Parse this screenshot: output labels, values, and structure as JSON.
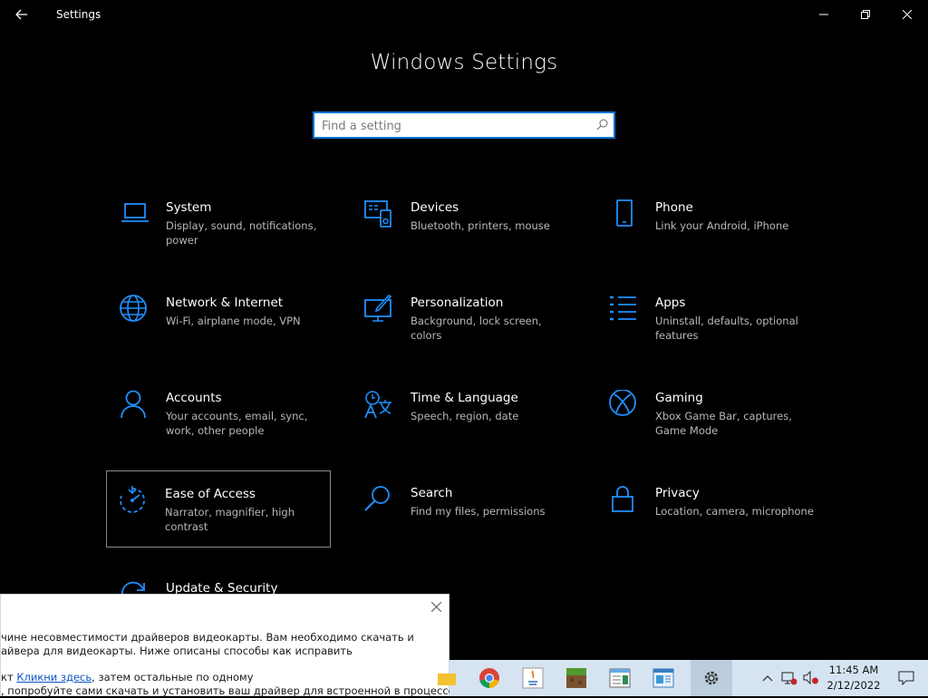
{
  "window": {
    "title": "Settings"
  },
  "heading": "Windows Settings",
  "search": {
    "placeholder": "Find a setting",
    "value": ""
  },
  "colors": {
    "accent": "#0a74d6",
    "background": "#000000",
    "taskbar": "#d6e4f2"
  },
  "tiles": [
    {
      "name": "System",
      "desc": "Display, sound, notifications, power",
      "icon": "laptop-icon"
    },
    {
      "name": "Devices",
      "desc": "Bluetooth, printers, mouse",
      "icon": "devices-icon"
    },
    {
      "name": "Phone",
      "desc": "Link your Android, iPhone",
      "icon": "phone-icon"
    },
    {
      "name": "Network & Internet",
      "desc": "Wi-Fi, airplane mode, VPN",
      "icon": "globe-icon"
    },
    {
      "name": "Personalization",
      "desc": "Background, lock screen, colors",
      "icon": "paint-icon"
    },
    {
      "name": "Apps",
      "desc": "Uninstall, defaults, optional features",
      "icon": "apps-list-icon"
    },
    {
      "name": "Accounts",
      "desc": "Your accounts, email, sync, work, other people",
      "icon": "person-icon"
    },
    {
      "name": "Time & Language",
      "desc": "Speech, region, date",
      "icon": "time-language-icon"
    },
    {
      "name": "Gaming",
      "desc": "Xbox Game Bar, captures, Game Mode",
      "icon": "xbox-icon"
    },
    {
      "name": "Ease of Access",
      "desc": "Narrator, magnifier, high contrast",
      "icon": "ease-of-access-icon"
    },
    {
      "name": "Search",
      "desc": "Find my files, permissions",
      "icon": "magnifier-icon"
    },
    {
      "name": "Privacy",
      "desc": "Location, camera, microphone",
      "icon": "lock-icon"
    },
    {
      "name": "Update & Security",
      "desc": "",
      "icon": "update-icon"
    }
  ],
  "popup": {
    "line1": "чине несовместимости драйверов видеокарты. Вам необходимо скачать и",
    "line2": "айвера для видеокарты. Ниже описаны способы как исправить",
    "line3_prefix": "кт ",
    "line3_link": "Кликни здесь",
    "line3_suffix": ", затем остальные по одному",
    "line4": ", попробуйте сами скачать и установить ваш драйвер для встроенной в процессор"
  },
  "taskbar": {
    "apps": [
      "folder-icon",
      "chrome-icon",
      "java-icon",
      "minecraft-icon",
      "notepad-icon",
      "control-panel-icon",
      "settings-gear-icon"
    ],
    "active_app": "settings-gear-icon",
    "time": "11:45 AM",
    "date": "2/12/2022"
  }
}
